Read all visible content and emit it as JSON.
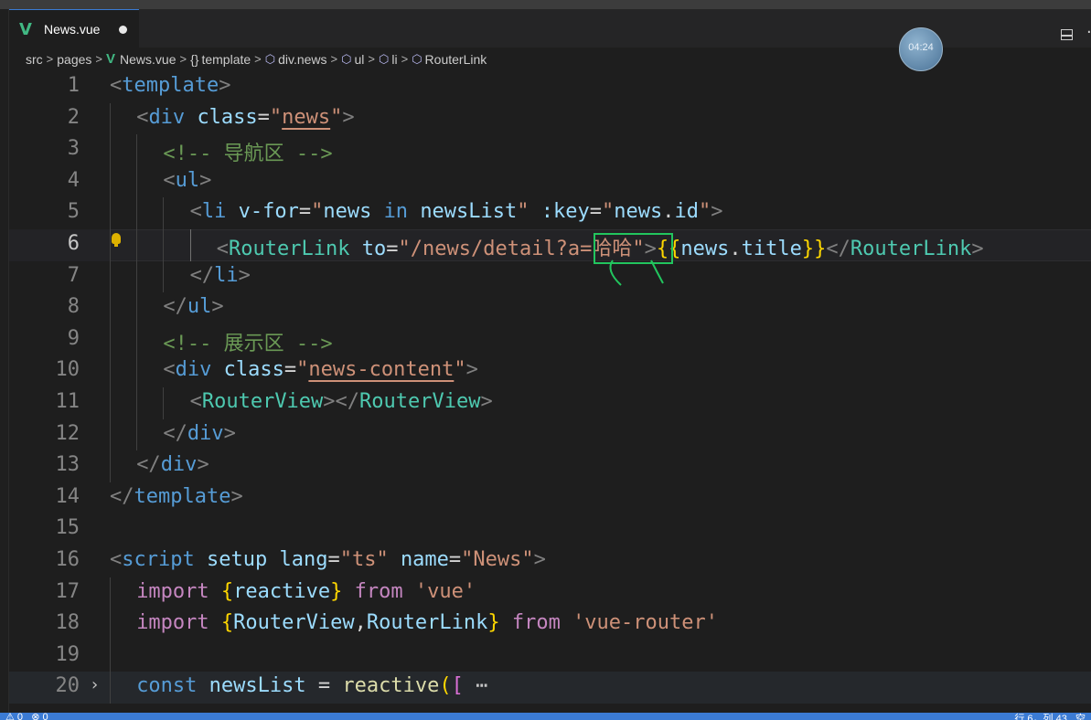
{
  "tab": {
    "label": "News.vue"
  },
  "timer": {
    "text": "04:24"
  },
  "breadcrumb": [
    "src",
    "pages",
    "News.vue",
    "template",
    "div.news",
    "ul",
    "li",
    "RouterLink"
  ],
  "editor": {
    "lines": [
      {
        "n": "1",
        "indent": 0,
        "tokens": [
          [
            "t-tag",
            "<"
          ],
          [
            "t-name",
            "template"
          ],
          [
            "t-tag",
            ">"
          ]
        ]
      },
      {
        "n": "2",
        "indent": 1,
        "tokens": [
          [
            "t-tag",
            "<"
          ],
          [
            "t-name",
            "div"
          ],
          [
            "t-txt",
            " "
          ],
          [
            "t-attr",
            "class"
          ],
          [
            "t-txt",
            "="
          ],
          [
            "t-str",
            "\""
          ],
          [
            "t-str u",
            "news"
          ],
          [
            "t-str",
            "\""
          ],
          [
            "t-tag",
            ">"
          ]
        ]
      },
      {
        "n": "3",
        "indent": 2,
        "tokens": [
          [
            "t-cmt",
            "<!-- 导航区 -->"
          ]
        ]
      },
      {
        "n": "4",
        "indent": 2,
        "tokens": [
          [
            "t-tag",
            "<"
          ],
          [
            "t-name",
            "ul"
          ],
          [
            "t-tag",
            ">"
          ]
        ]
      },
      {
        "n": "5",
        "indent": 3,
        "tokens": [
          [
            "t-tag",
            "<"
          ],
          [
            "t-name",
            "li"
          ],
          [
            "t-txt",
            " "
          ],
          [
            "t-attr",
            "v-for"
          ],
          [
            "t-txt",
            "="
          ],
          [
            "t-str",
            "\""
          ],
          [
            "t-attr",
            "news"
          ],
          [
            "t-txt",
            " "
          ],
          [
            "t-kw",
            "in"
          ],
          [
            "t-txt",
            " "
          ],
          [
            "t-attr",
            "newsList"
          ],
          [
            "t-str",
            "\""
          ],
          [
            "t-txt",
            " "
          ],
          [
            "t-attr",
            ":key"
          ],
          [
            "t-txt",
            "="
          ],
          [
            "t-str",
            "\""
          ],
          [
            "t-attr",
            "news"
          ],
          [
            "t-txt",
            "."
          ],
          [
            "t-attr",
            "id"
          ],
          [
            "t-str",
            "\""
          ],
          [
            "t-tag",
            ">"
          ]
        ]
      },
      {
        "n": "6",
        "indent": 4,
        "current": true,
        "bulb": true,
        "tokens": [
          [
            "t-tag",
            "<"
          ],
          [
            "t-comp",
            "RouterLink"
          ],
          [
            "t-txt",
            " "
          ],
          [
            "t-attr",
            "to"
          ],
          [
            "t-txt",
            "="
          ],
          [
            "t-str",
            "\"/news/detail?a=哈哈\""
          ],
          [
            "t-tag",
            ">"
          ],
          [
            "t-mus",
            "{{"
          ],
          [
            "t-attr",
            "news"
          ],
          [
            "t-txt",
            "."
          ],
          [
            "t-attr",
            "title"
          ],
          [
            "t-mus",
            "}}"
          ],
          [
            "t-tag",
            "</"
          ],
          [
            "t-comp",
            "RouterLink"
          ],
          [
            "t-tag",
            ">"
          ]
        ]
      },
      {
        "n": "7",
        "indent": 3,
        "tokens": [
          [
            "t-tag",
            "</"
          ],
          [
            "t-name",
            "li"
          ],
          [
            "t-tag",
            ">"
          ]
        ]
      },
      {
        "n": "8",
        "indent": 2,
        "tokens": [
          [
            "t-tag",
            "</"
          ],
          [
            "t-name",
            "ul"
          ],
          [
            "t-tag",
            ">"
          ]
        ]
      },
      {
        "n": "9",
        "indent": 2,
        "tokens": [
          [
            "t-cmt",
            "<!-- 展示区 -->"
          ]
        ]
      },
      {
        "n": "10",
        "indent": 2,
        "tokens": [
          [
            "t-tag",
            "<"
          ],
          [
            "t-name",
            "div"
          ],
          [
            "t-txt",
            " "
          ],
          [
            "t-attr",
            "class"
          ],
          [
            "t-txt",
            "="
          ],
          [
            "t-str",
            "\""
          ],
          [
            "t-str u",
            "news-content"
          ],
          [
            "t-str",
            "\""
          ],
          [
            "t-tag",
            ">"
          ]
        ]
      },
      {
        "n": "11",
        "indent": 3,
        "tokens": [
          [
            "t-tag",
            "<"
          ],
          [
            "t-comp",
            "RouterView"
          ],
          [
            "t-tag",
            "></"
          ],
          [
            "t-comp",
            "RouterView"
          ],
          [
            "t-tag",
            ">"
          ]
        ]
      },
      {
        "n": "12",
        "indent": 2,
        "tokens": [
          [
            "t-tag",
            "</"
          ],
          [
            "t-name",
            "div"
          ],
          [
            "t-tag",
            ">"
          ]
        ]
      },
      {
        "n": "13",
        "indent": 1,
        "tokens": [
          [
            "t-tag",
            "</"
          ],
          [
            "t-name",
            "div"
          ],
          [
            "t-tag",
            ">"
          ]
        ]
      },
      {
        "n": "14",
        "indent": 0,
        "tokens": [
          [
            "t-tag",
            "</"
          ],
          [
            "t-name",
            "template"
          ],
          [
            "t-tag",
            ">"
          ]
        ]
      },
      {
        "n": "15",
        "indent": 0,
        "tokens": []
      },
      {
        "n": "16",
        "indent": 0,
        "tokens": [
          [
            "t-tag",
            "<"
          ],
          [
            "t-name",
            "script"
          ],
          [
            "t-txt",
            " "
          ],
          [
            "t-attr",
            "setup"
          ],
          [
            "t-txt",
            " "
          ],
          [
            "t-attr",
            "lang"
          ],
          [
            "t-txt",
            "="
          ],
          [
            "t-str",
            "\"ts\""
          ],
          [
            "t-txt",
            " "
          ],
          [
            "t-attr",
            "name"
          ],
          [
            "t-txt",
            "="
          ],
          [
            "t-str",
            "\"News\""
          ],
          [
            "t-tag",
            ">"
          ]
        ]
      },
      {
        "n": "17",
        "indent": 1,
        "tokens": [
          [
            "t-import",
            "import"
          ],
          [
            "t-txt",
            " "
          ],
          [
            "t-brace",
            "{"
          ],
          [
            "t-attr",
            "reactive"
          ],
          [
            "t-brace",
            "}"
          ],
          [
            "t-txt",
            " "
          ],
          [
            "t-import",
            "from"
          ],
          [
            "t-txt",
            " "
          ],
          [
            "t-str",
            "'vue'"
          ]
        ]
      },
      {
        "n": "18",
        "indent": 1,
        "tokens": [
          [
            "t-import",
            "import"
          ],
          [
            "t-txt",
            " "
          ],
          [
            "t-brace",
            "{"
          ],
          [
            "t-attr",
            "RouterView"
          ],
          [
            "t-txt",
            ","
          ],
          [
            "t-attr",
            "RouterLink"
          ],
          [
            "t-brace",
            "}"
          ],
          [
            "t-txt",
            " "
          ],
          [
            "t-import",
            "from"
          ],
          [
            "t-txt",
            " "
          ],
          [
            "t-str",
            "'vue-router'"
          ]
        ]
      },
      {
        "n": "19",
        "indent": 1,
        "tokens": []
      },
      {
        "n": "20",
        "indent": 1,
        "folded": true,
        "tokens": [
          [
            "t-kw",
            "const"
          ],
          [
            "t-txt",
            " "
          ],
          [
            "t-attr",
            "newsList"
          ],
          [
            "t-txt",
            " = "
          ],
          [
            "t-fn",
            "reactive"
          ],
          [
            "t-brace",
            "("
          ],
          [
            "t-bracket",
            "["
          ],
          [
            "t-txt",
            " "
          ],
          [
            "t-more",
            "⋯"
          ]
        ]
      }
    ]
  },
  "status": {
    "left": "⚠ 0   ⊗ 0",
    "right": "行 6，列 43   空"
  },
  "colors": {
    "accent": "#3b7bd4",
    "annotation": "#22c55e",
    "vue_green": "#41b883"
  }
}
